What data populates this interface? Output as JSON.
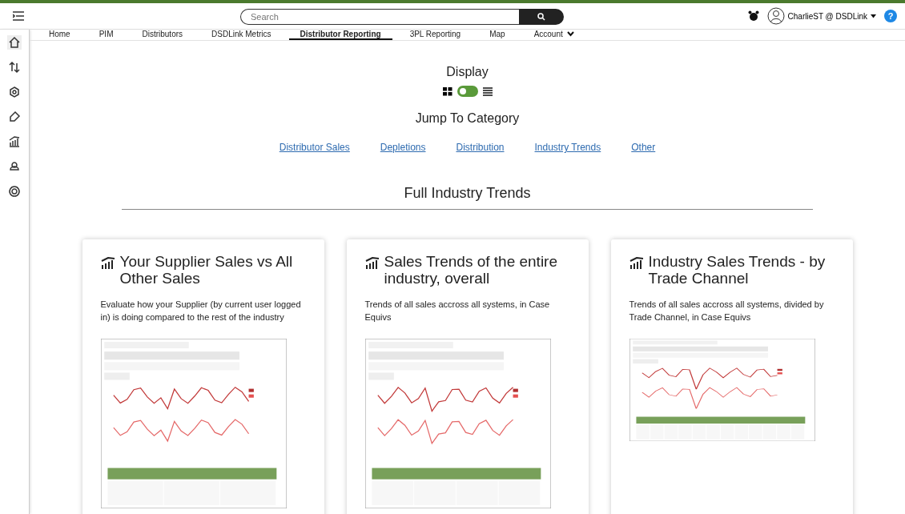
{
  "header": {
    "search": {
      "placeholder": "Search"
    },
    "user": "CharlieST @ DSDLink",
    "help": "?"
  },
  "sidebar": {
    "items": [
      {
        "selected": true
      },
      {
        "selected": false
      },
      {
        "selected": false
      },
      {
        "selected": false
      },
      {
        "selected": false
      },
      {
        "selected": false
      },
      {
        "selected": false
      }
    ]
  },
  "tabs": [
    {
      "label": "Home",
      "selected": false
    },
    {
      "label": "PIM",
      "selected": false
    },
    {
      "label": "Distributors",
      "selected": false
    },
    {
      "label": "DSDLink Metrics",
      "selected": false
    },
    {
      "label": "Distributor Reporting",
      "selected": true
    },
    {
      "label": "3PL Reporting",
      "selected": false
    },
    {
      "label": "Map",
      "selected": false
    },
    {
      "label": "Account",
      "selected": false,
      "dropdown": true
    }
  ],
  "display": {
    "title": "Display",
    "toggle": {
      "on": false
    }
  },
  "jump": {
    "title": "Jump To Category",
    "links": [
      "Distributor Sales",
      "Depletions",
      "Distribution",
      "Industry Trends",
      "Other"
    ]
  },
  "section": {
    "title": "Full Industry Trends"
  },
  "cards": [
    {
      "title": "Your Supplier Sales vs All Other Sales",
      "description": "Evaluate how your Supplier (by current user logged in) is doing compared to the rest of the industry"
    },
    {
      "title": "Sales Trends of the entire industry, overall",
      "description": "Trends of all sales accross all systems, in Case Equivs"
    },
    {
      "title": "Industry Sales Trends - by Trade Channel",
      "description": "Trends of all sales accross all systems, divided by Trade Channel, in Case Equivs"
    }
  ]
}
